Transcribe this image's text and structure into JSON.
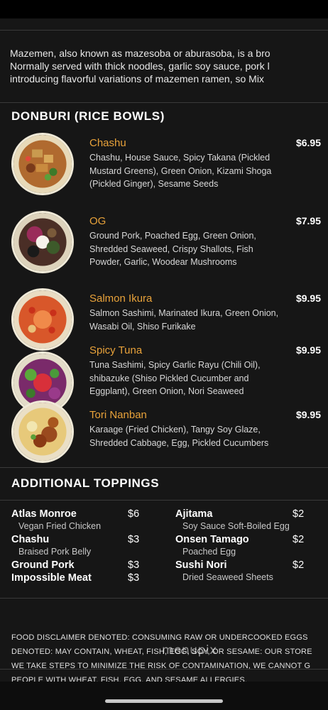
{
  "intro": {
    "line1": "Mazemen, also known as mazesoba or aburasoba, is a bro",
    "line2": "Normally served with thick noodles, garlic soy sauce, pork l",
    "line3": "introducing flavorful variations of mazemen ramen, so Mix"
  },
  "donburi": {
    "title": "DONBURI (RICE BOWLS)",
    "items": [
      {
        "name": "Chashu",
        "price": "$6.95",
        "desc": "Chashu, House Sauce, Spicy Takana (Pickled Mustard Greens), Green Onion, Kizami Shoga (Pickled Ginger), Sesame Seeds"
      },
      {
        "name": "OG",
        "price": "$7.95",
        "desc": "Ground Pork, Poached Egg, Green Onion, Shredded Seaweed, Crispy Shallots, Fish Powder, Garlic, Woodear Mushrooms"
      },
      {
        "name": "Salmon Ikura",
        "price": "$9.95",
        "desc": "Salmon Sashimi, Marinated Ikura, Green Onion, Wasabi Oil, Shiso Furikake"
      },
      {
        "name": "Spicy Tuna",
        "price": "$9.95",
        "desc": "Tuna Sashimi, Spicy Garlic Rayu (Chili Oil), shibazuke (Shiso Pickled Cucumber and Eggplant), Green Onion, Nori Seaweed"
      },
      {
        "name": "Tori Nanban",
        "price": "$9.95",
        "desc": "Karaage (Fried Chicken), Tangy Soy Glaze, Shredded Cabbage, Egg, Pickled Cucumbers"
      }
    ]
  },
  "toppings": {
    "title": "ADDITIONAL TOPPINGS",
    "left": [
      {
        "name": "Atlas Monroe",
        "price": "$6",
        "sub": "Vegan Fried Chicken"
      },
      {
        "name": "Chashu",
        "price": "$3",
        "sub": "Braised Pork Belly"
      },
      {
        "name": "Ground Pork",
        "price": "$3",
        "sub": ""
      },
      {
        "name": "Impossible Meat",
        "price": "$3",
        "sub": ""
      }
    ],
    "right": [
      {
        "name": "Ajitama",
        "price": "$2",
        "sub": "Soy Sauce Soft-Boiled Egg"
      },
      {
        "name": "Onsen Tamago",
        "price": "$2",
        "sub": "Poached Egg"
      },
      {
        "name": "Sushi Nori",
        "price": "$2",
        "sub": "Dried Seaweed Sheets"
      }
    ]
  },
  "disclaimer": {
    "line1": "FOOD DISCLAIMER DENOTED: CONSUMING RAW OR UNDERCOOKED EGGS",
    "line2": "DENOTED: MAY CONTAIN, WHEAT, FISH, EGG, SOY, OR SESAME: OUR STORE",
    "line3": "WE TAKE STEPS TO MINIMIZE THE RISK OF CONTAMINATION, WE CANNOT G",
    "line4": "PEOPLE WITH WHEAT, FISH, EGG, AND SESAME ALLERGIES."
  },
  "watermark": "menupix",
  "colors": {
    "accent": "#e8a23a",
    "background": "#161616",
    "text": "#ffffff"
  }
}
